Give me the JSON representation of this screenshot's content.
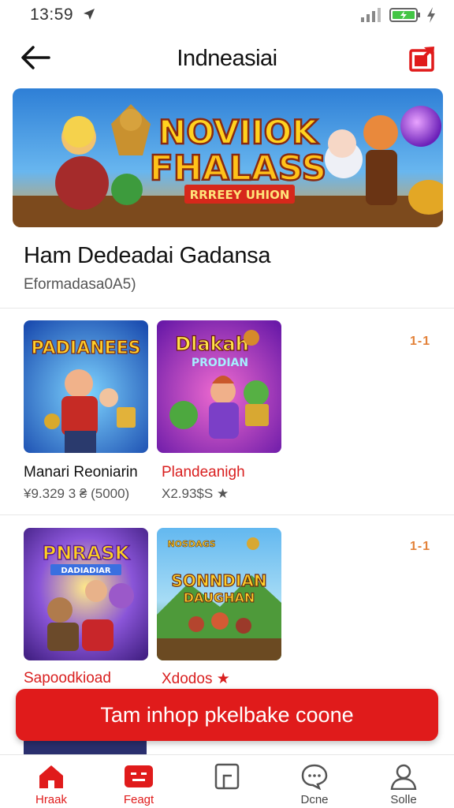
{
  "status_bar": {
    "time": "13:59"
  },
  "header": {
    "title": "Indneasiai"
  },
  "banner": {
    "title_line1": "NOVIIOK",
    "title_line2": "FHALASS",
    "tagline": "RRREEY UHION"
  },
  "section": {
    "title": "Ham Dedeadai Gadansa",
    "subtitle": "Eformadasa0A5)"
  },
  "games": [
    {
      "cover_title": "PADIANEES",
      "title": "Manari Reoniarin",
      "meta": "¥9.329 3 ₴ (5000)",
      "rank": "1-1"
    },
    {
      "cover_title": "Dlakah",
      "cover_subtitle": "PRODIAN",
      "title": "Plandeanigh",
      "meta": "X2.93$S ★",
      "rank": ""
    },
    {
      "cover_title": "PNRASK",
      "cover_subtitle": "DADIADIAR",
      "title": "Sapoodkioad",
      "meta": "",
      "rank": "1-1"
    },
    {
      "cover_title": "SONNDIAN",
      "cover_subtitle": "DAUGHAN",
      "cover_top": "NOSDAGS",
      "title": "Xdodos ★",
      "meta": "",
      "rank": ""
    }
  ],
  "cta": {
    "label": "Tam inhop pkelbake coone"
  },
  "bottom_nav": [
    {
      "label": "Hraak",
      "icon": "home-icon",
      "active": true
    },
    {
      "label": "Feagt",
      "icon": "games-icon",
      "active": true
    },
    {
      "label": "",
      "icon": "apps-icon",
      "active": false
    },
    {
      "label": "Dcne",
      "icon": "chat-icon",
      "active": false
    },
    {
      "label": "Solle",
      "icon": "profile-icon",
      "active": false
    }
  ],
  "colors": {
    "accent": "#e01b1b",
    "rank": "#e3823a"
  }
}
